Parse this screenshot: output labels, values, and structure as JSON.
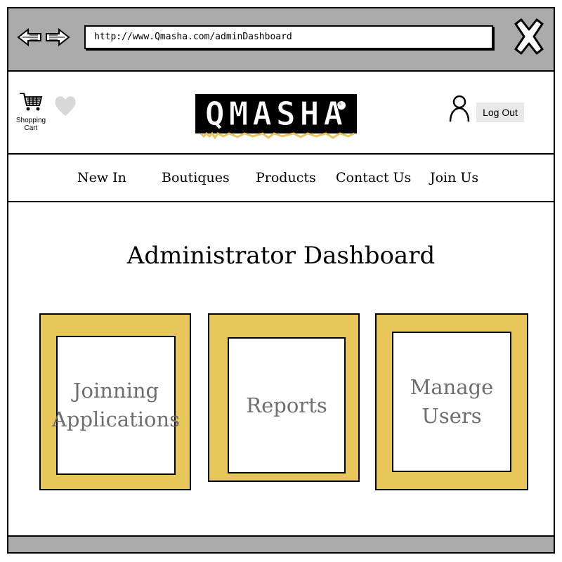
{
  "browser": {
    "url": "http://www.Qmasha.com/adminDashboard"
  },
  "header": {
    "cart_label": "Shopping Cart",
    "logo_text": "QMASHA",
    "logout_label": "Log Out"
  },
  "nav": {
    "items": [
      {
        "label": "New In"
      },
      {
        "label": "Boutiques"
      },
      {
        "label": "Products"
      },
      {
        "label": "Contact Us"
      },
      {
        "label": "Join Us"
      }
    ]
  },
  "main": {
    "title": "Administrator Dashboard",
    "cards": [
      {
        "label": "Joinning Applications"
      },
      {
        "label": "Reports"
      },
      {
        "label": "Manage Users"
      }
    ]
  },
  "colors": {
    "card_border": "#e8c75a",
    "bar_gray": "#aaaaaa",
    "card_text": "#6e6e6e"
  }
}
